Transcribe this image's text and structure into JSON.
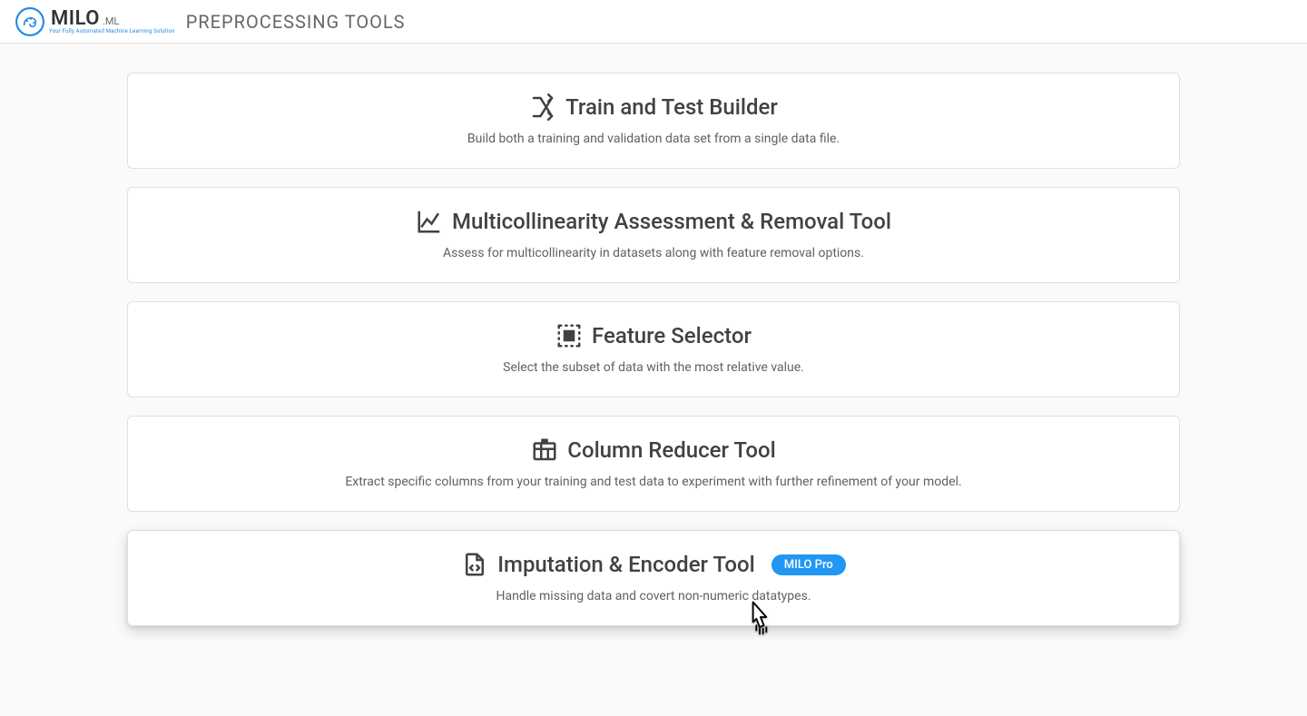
{
  "header": {
    "brand_main": "MILO",
    "brand_sub": "ML",
    "brand_tagline": "Your Fully Automated Machine Learning Solution",
    "page_title": "PREPROCESSING TOOLS"
  },
  "cards": [
    {
      "icon": "shuffle",
      "title": "Train and Test Builder",
      "desc": "Build both a training and validation data set from a single data file.",
      "badge": null,
      "hovered": false
    },
    {
      "icon": "chart-line",
      "title": "Multicollinearity Assessment & Removal Tool",
      "desc": "Assess for multicollinearity in datasets along with feature removal options.",
      "badge": null,
      "hovered": false
    },
    {
      "icon": "select-all",
      "title": "Feature Selector",
      "desc": "Select the subset of data with the most relative value.",
      "badge": null,
      "hovered": false
    },
    {
      "icon": "table-columns",
      "title": "Column Reducer Tool",
      "desc": "Extract specific columns from your training and test data to experiment with further refinement of your model.",
      "badge": null,
      "hovered": false
    },
    {
      "icon": "file-code",
      "title": "Imputation & Encoder Tool",
      "desc": "Handle missing data and covert non-numeric datatypes.",
      "badge": "MILO Pro",
      "hovered": true
    }
  ],
  "colors": {
    "accent": "#2196f3",
    "text": "#424242",
    "muted": "#616161",
    "border": "#e0e0e0",
    "bg": "#fafafa"
  }
}
